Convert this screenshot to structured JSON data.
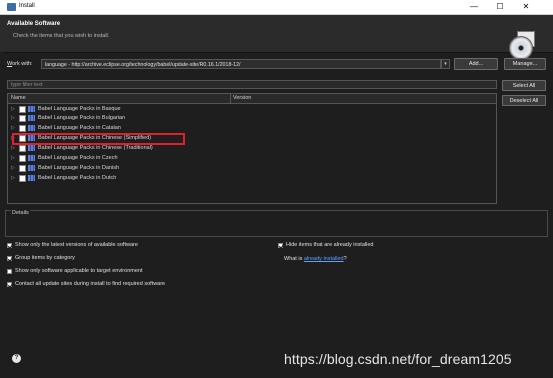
{
  "window": {
    "title": "Install",
    "min": "—",
    "max": "☐",
    "close": "✕"
  },
  "header": {
    "title": "Available Software",
    "subtitle": "Check the items that you wish to install."
  },
  "workwith": {
    "label_prefix": "W",
    "label_rest": "ork with:",
    "value": "language - http://archive.eclipse.org/technology/babel/update-site/R0.16.1/2018-12/",
    "add": "Add...",
    "manage": "Manage..."
  },
  "filter": {
    "placeholder": "type filter text"
  },
  "side_buttons": {
    "select_all": "Select All",
    "deselect_all": "Deselect All"
  },
  "tree": {
    "columns": {
      "name": "Name",
      "version": "Version"
    },
    "rows": [
      "Babel Language Packs in Basque",
      "Babel Language Packs in Bulgarian",
      "Babel Language Packs in Catalan",
      "Babel Language Packs in Chinese (Simplified)",
      "Babel Language Packs in Chinese (Traditional)",
      "Babel Language Packs in Czech",
      "Babel Language Packs in Danish",
      "Babel Language Packs in Dutch"
    ]
  },
  "details": {
    "label": "Details"
  },
  "options": {
    "latest_only": "Show only the latest versions of available software",
    "group_by_category": "Group items by category",
    "target_env": "Show only software applicable to target environment",
    "contact_sites": "Contact all update sites during install to find required software",
    "hide_installed": "Hide items that are already installed",
    "what_is": "What is",
    "already_installed": "already installed",
    "question": "?"
  },
  "footer": {
    "help": "?",
    "watermark": "https://blog.csdn.net/for_dream1205"
  },
  "colors": {
    "accent_highlight": "#e0202f",
    "link": "#5fa0ff",
    "background": "#1e1e1e"
  }
}
